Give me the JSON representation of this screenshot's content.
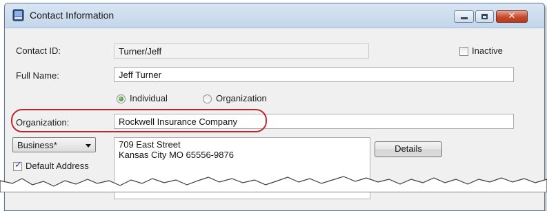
{
  "window": {
    "title": "Contact Information",
    "controls": {
      "close_glyph": "✕"
    }
  },
  "form": {
    "contact_id": {
      "label": "Contact ID:",
      "value": "Turner/Jeff"
    },
    "inactive": {
      "label": "Inactive",
      "checked": false
    },
    "full_name": {
      "label": "Full Name:",
      "value": "Jeff Turner"
    },
    "type_options": [
      {
        "label": "Individual",
        "selected": true
      },
      {
        "label": "Organization",
        "selected": false
      }
    ],
    "organization": {
      "label": "Organization:",
      "value": "Rockwell Insurance Company"
    },
    "address_type": {
      "selected": "Business*"
    },
    "default_address": {
      "label": "Default Address",
      "checked": true,
      "tick": "✓"
    },
    "address": {
      "line1": "709 East Street",
      "line2": "Kansas City MO  65556-9876"
    },
    "details_button": "Details"
  },
  "colors": {
    "highlight": "#c0272d",
    "window_border": "#5f7a95",
    "titlebar": "#c4d6ea",
    "form_background": "#f0f0f0"
  },
  "icons": [
    "app-icon",
    "minimize-icon",
    "maximize-icon",
    "close-icon",
    "chevron-down-icon",
    "check-icon"
  ]
}
